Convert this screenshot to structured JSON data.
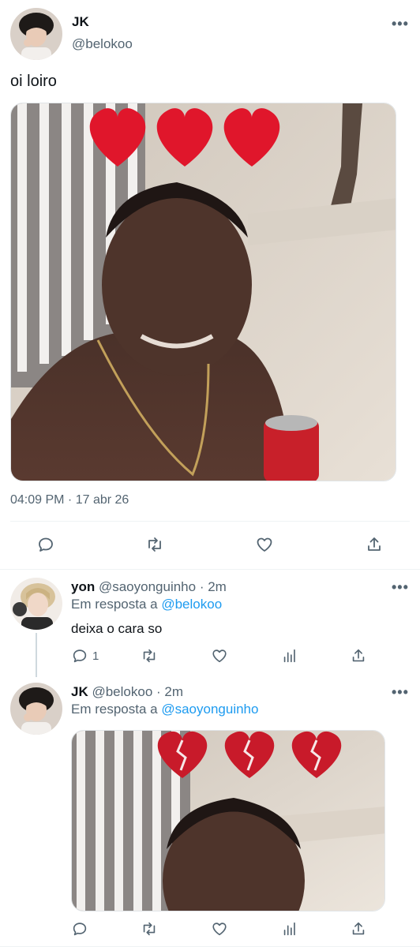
{
  "main_tweet": {
    "display_name": "JK",
    "handle": "@belokoo",
    "text": "oi loiro",
    "timestamp": "04:09 PM · 17 abr 26",
    "more_icon": "more-horizontal-icon"
  },
  "replies": [
    {
      "display_name": "yon",
      "handle": "@saoyonguinho",
      "time": "· 2m",
      "reply_prefix": "Em resposta a",
      "reply_to": "@belokoo",
      "text": "deixa o cara so",
      "reply_count": "1"
    },
    {
      "display_name": "JK",
      "handle": "@belokoo",
      "time": "· 2m",
      "reply_prefix": "Em resposta a",
      "reply_to": "@saoyonguinho"
    }
  ],
  "colors": {
    "link": "#1d9bf0",
    "secondary_text": "#536471",
    "heart_red": "#e0162b"
  },
  "icons": [
    "reply-icon",
    "retweet-icon",
    "like-icon",
    "share-icon",
    "views-icon"
  ]
}
